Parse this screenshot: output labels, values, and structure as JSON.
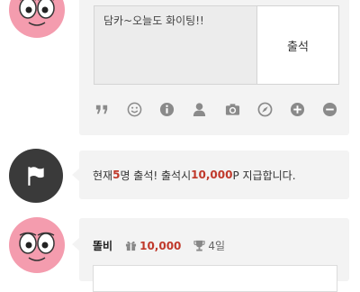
{
  "composer": {
    "input_value": "담카~오늘도 화이팅!!",
    "submit_label": "출석",
    "tools": [
      "quote-icon",
      "emoticon-icon",
      "info-icon",
      "user-icon",
      "camera-icon",
      "compass-icon",
      "plus-circle-icon",
      "minus-circle-icon"
    ]
  },
  "notice": {
    "prefix": "현재 ",
    "count": "5",
    "middle": "명 출석! 출석시 ",
    "points": "10,000",
    "suffix": "P 지급합니다."
  },
  "comment": {
    "nickname": "똘비",
    "points": "10,000",
    "days": "4일"
  },
  "colors": {
    "accent": "#c0392b",
    "panel": "#f3f3f3",
    "icon": "#8a8a8a",
    "avatar_pink": "#f49cae"
  }
}
